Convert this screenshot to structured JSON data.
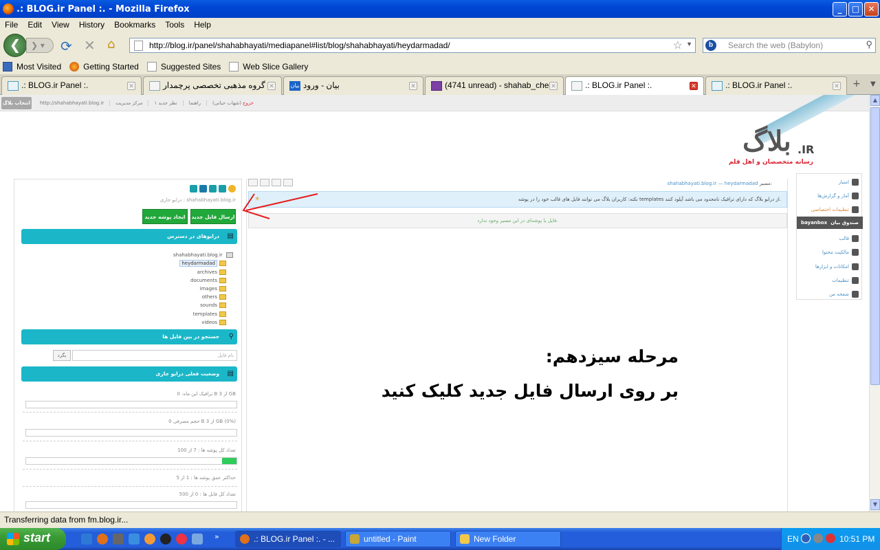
{
  "window": {
    "title": ".: BLOG.ir Panel :. - Mozilla Firefox",
    "min": "_",
    "max": "□",
    "close": "✕"
  },
  "menu": [
    "File",
    "Edit",
    "View",
    "History",
    "Bookmarks",
    "Tools",
    "Help"
  ],
  "nav": {
    "url": "http://blog.ir/panel/shahabhayati/mediapanel#list/blog/shahabhayati/heydarmadad/",
    "search_placeholder": "Search the web (Babylon)"
  },
  "bookmarks": [
    "Most Visited",
    "Getting Started",
    "Suggested Sites",
    "Web Slice Gallery"
  ],
  "tabs": [
    {
      "label": ".: BLOG.ir Panel :."
    },
    {
      "label": "گروه مذهبی تخصصی پرچمدار"
    },
    {
      "label": "بیان - ورود",
      "badge": "بیان"
    },
    {
      "label": "(4741 unread) - shahab_cher..."
    },
    {
      "label": ".: BLOG.ir Panel :."
    },
    {
      "label": ".: BLOG.ir Panel :."
    }
  ],
  "blog": {
    "topbar": {
      "select_blog": "انتخاب بلاگ",
      "blog_url": "http://shahabhayati.blog.ir",
      "admin_center": "مرکز مدیریت",
      "comments": "۱ نظر جدید",
      "help": "راهنما",
      "user": "(شهاب حیاتی)",
      "logout": "خروج"
    },
    "logo": {
      "wordmark": "بلاگ",
      "ir": ".IR",
      "tagline": "رسانه متخصصان و اهل قلم"
    },
    "left": {
      "current_path": "درایو جاری : shahabhayati.blog.ir",
      "upload_button": "ارسال فایل جدید",
      "new_folder_button": "ایجاد پوشه جدید",
      "drives_title": "درایوهای در دسترس",
      "tree_root": "shahabhayati.blog.ir",
      "folders": [
        "heydarmadad",
        "archives",
        "documents",
        "images",
        "others",
        "sounds",
        "templates",
        "videos"
      ],
      "search_title": "جستجو در بین فایل ها",
      "search_placeholder": "نام فایل",
      "search_button": "بگرد",
      "status_title": "وضعیت فعلی درایو جاری",
      "stats": [
        {
          "label": "ترافیک این ماه: 0 B از 3 GB",
          "percent": 0
        },
        {
          "label": "حجم مصرفی 0 B از 3 GB (0%)",
          "percent": 0
        },
        {
          "label": "تعداد کل پوشه ها : 7 از 100",
          "percent": 7
        },
        {
          "label": "حداکثر عمق پوشه ها : 1 از 5",
          "percent": 0
        },
        {
          "label": "تعداد کل فایل ها : 0 از 500",
          "percent": 0
        }
      ]
    },
    "center": {
      "breadcrumb_label": "مسیر:",
      "breadcrumb": "shahabhayati.blog.ir — heydarmadad",
      "note": "نکته: کاربران بلاگ می توانند فایل های قالب خود را در پوشه templates از درایو بلاگ که دارای ترافیک نامحدود می باشد آپلود کنند.",
      "empty": "فایل یا پوشه‌ای در این مسیر وجود ندارد.",
      "instruction_title": "مرحله سیزدهم:",
      "instruction_body": "بر روی ارسال فایل جدید کلیک کنید"
    },
    "right": {
      "items": [
        "امتیاز",
        "آمار و گزارش‌ها",
        "تنظیمات اختصاصی",
        "قالب",
        "مالکیت محتوا",
        "امکانات و ابزارها",
        "تنظیمات",
        "صفحه من"
      ],
      "bayanbox": "bayanbox",
      "bayanbox_label": "صندوق بیان"
    }
  },
  "status": "Transferring data from fm.blog.ir...",
  "taskbar": {
    "start": "start",
    "buttons": [
      ".: BLOG.ir Panel :. - ...",
      "untitled - Paint",
      "New Folder"
    ],
    "lang": "EN",
    "time": "10:51 PM"
  }
}
